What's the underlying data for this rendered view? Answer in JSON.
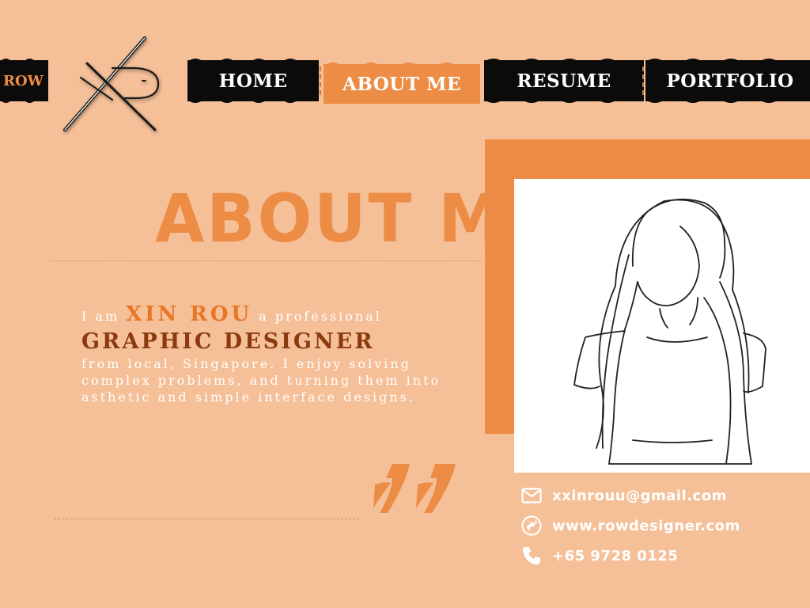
{
  "brand": {
    "tab_label": "ROW",
    "logo_icon": "xr-monogram-logo"
  },
  "nav": {
    "items": [
      {
        "label": "HOME",
        "active": false
      },
      {
        "label": "ABOUT ME",
        "active": true
      },
      {
        "label": "RESUME",
        "active": false
      },
      {
        "label": "PORTFOLIO",
        "active": false
      }
    ]
  },
  "hero": {
    "title": "ABOUT ME"
  },
  "intro": {
    "prefix": "I am",
    "name": "XIN ROU",
    "after_name": "a professional",
    "role": "GRAPHIC DESIGNER",
    "body": "from local, Singapore.  I enjoy solving complex problems, and turning them into asthetic and simple interface designs."
  },
  "contact": {
    "email": "xxinrouu@gmail.com",
    "website": "www.rowdesigner.com",
    "phone": "+65 9728 0125"
  },
  "icons": [
    "envelope-icon",
    "globe-icon",
    "phone-icon",
    "quote-mark-icon",
    "portrait-sketch"
  ],
  "colors": {
    "background": "#f5bf98",
    "accent": "#ec8c45",
    "nav": "#0d0b0a",
    "role": "#8b3a0e",
    "name": "#e87625"
  }
}
